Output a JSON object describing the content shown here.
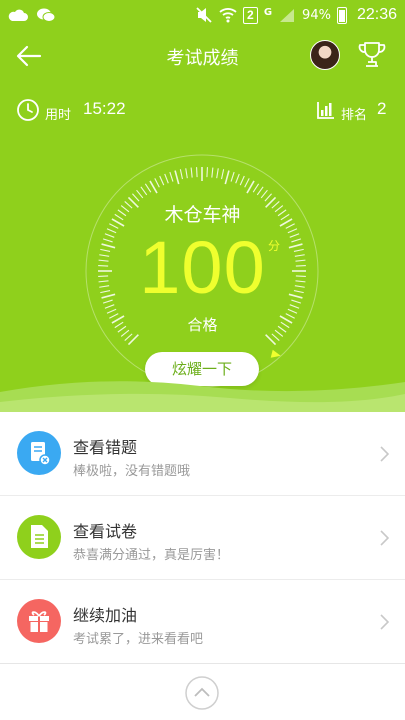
{
  "status_bar": {
    "sim_label": "2",
    "network_label": "G",
    "battery": "94%",
    "time": "22:36"
  },
  "nav": {
    "title": "考试成绩"
  },
  "stats": {
    "time_label": "用时",
    "time_value": "15:22",
    "rank_label": "排名",
    "rank_value": "2"
  },
  "result": {
    "nickname": "木仓车神",
    "score": "100",
    "score_unit": "分",
    "pass_label": "合格",
    "share_button": "炫耀一下"
  },
  "list": [
    {
      "title": "查看错题",
      "subtitle": "棒极啦，没有错题哦",
      "icon": "wrong-questions-icon",
      "color": "#3aa9f2"
    },
    {
      "title": "查看试卷",
      "subtitle": "恭喜满分通过，真是厉害！",
      "icon": "exam-paper-icon",
      "color": "#8fd01c"
    },
    {
      "title": "继续加油",
      "subtitle": "考试累了，进来看看吧",
      "icon": "gift-icon",
      "color": "#f56661"
    }
  ],
  "colors": {
    "brand_green": "#8fd01c",
    "score_yellow": "#efff2e"
  }
}
